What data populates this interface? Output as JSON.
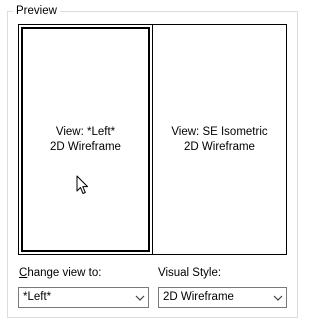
{
  "preview": {
    "group_title": "Preview",
    "left_viewport": {
      "view_line": "View: *Left*",
      "style_line": "2D Wireframe"
    },
    "right_viewport": {
      "view_line": "View: SE Isometric",
      "style_line": "2D Wireframe"
    }
  },
  "change_view": {
    "label_accel": "C",
    "label_rest": "hange view to:",
    "selected": "*Left*"
  },
  "visual_style": {
    "label": "Visual Style:",
    "selected": "2D Wireframe"
  },
  "icons": {
    "cursor": "mouse-pointer-icon",
    "dropdown": "chevron-down-icon"
  },
  "colors": {
    "group_border": "#dcdcdc",
    "combo_border": "#7a7a7a"
  }
}
